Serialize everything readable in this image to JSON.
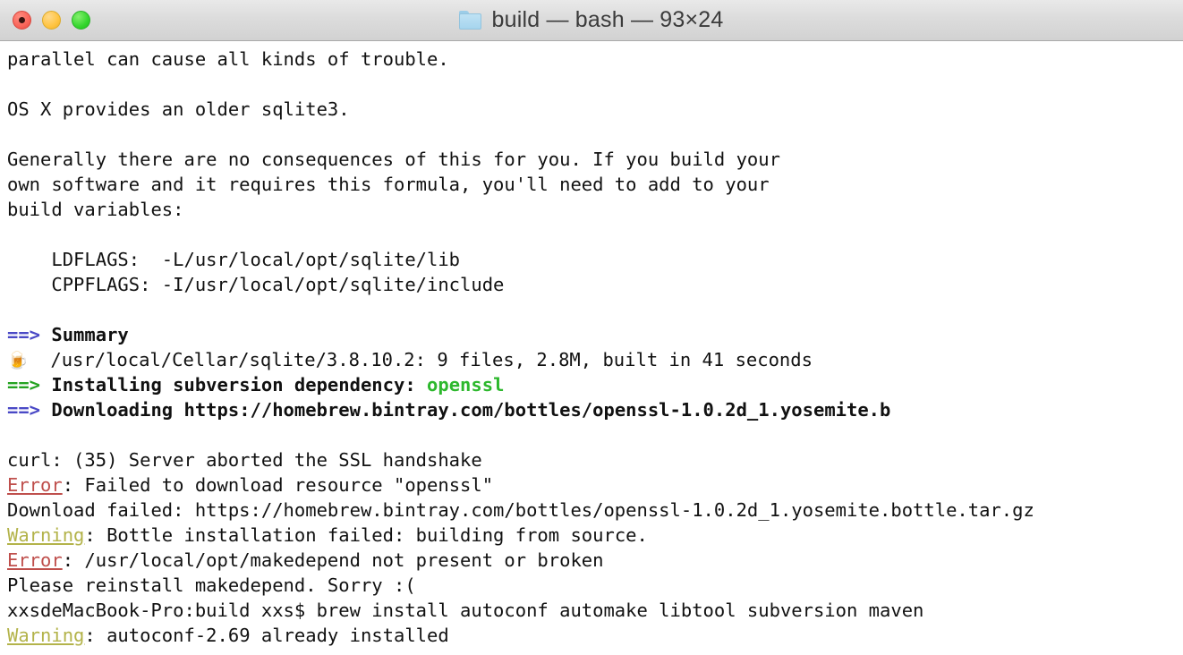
{
  "window": {
    "title": "build — bash — 93×24",
    "folder_icon": "folder-icon",
    "controls": {
      "close_label": "close",
      "minimize_label": "minimize",
      "maximize_label": "maximize"
    }
  },
  "terminal": {
    "columns": 93,
    "rows": 24,
    "background_color": "#ffffff",
    "foreground_color": "#111111",
    "colors": {
      "arrow_blue": "#4a49c6",
      "arrow_green": "#24a321",
      "green": "#2db82d",
      "error_red": "#bf4f4c",
      "warning_yellow": "#b3b34a"
    },
    "lines": [
      {
        "id": "l01",
        "segments": [
          {
            "text": "parallel can cause all kinds of trouble.",
            "style": "plain"
          }
        ]
      },
      {
        "id": "l02",
        "segments": [
          {
            "text": "",
            "style": "plain"
          }
        ]
      },
      {
        "id": "l03",
        "segments": [
          {
            "text": "OS X provides an older sqlite3.",
            "style": "plain"
          }
        ]
      },
      {
        "id": "l04",
        "segments": [
          {
            "text": "",
            "style": "plain"
          }
        ]
      },
      {
        "id": "l05",
        "segments": [
          {
            "text": "Generally there are no consequences of this for you. If you build your",
            "style": "plain"
          }
        ]
      },
      {
        "id": "l06",
        "segments": [
          {
            "text": "own software and it requires this formula, you'll need to add to your",
            "style": "plain"
          }
        ]
      },
      {
        "id": "l07",
        "segments": [
          {
            "text": "build variables:",
            "style": "plain"
          }
        ]
      },
      {
        "id": "l08",
        "segments": [
          {
            "text": "",
            "style": "plain"
          }
        ]
      },
      {
        "id": "l09",
        "segments": [
          {
            "text": "    LDFLAGS:  -L/usr/local/opt/sqlite/lib",
            "style": "plain"
          }
        ]
      },
      {
        "id": "l10",
        "segments": [
          {
            "text": "    CPPFLAGS: -I/usr/local/opt/sqlite/include",
            "style": "plain"
          }
        ]
      },
      {
        "id": "l11",
        "segments": [
          {
            "text": "",
            "style": "plain"
          }
        ]
      },
      {
        "id": "l12",
        "segments": [
          {
            "text": "==>",
            "style": "arrow"
          },
          {
            "text": " Summary",
            "style": "bold"
          }
        ]
      },
      {
        "id": "l13",
        "segments": [
          {
            "text": "🍺",
            "style": "beer"
          },
          {
            "text": "  /usr/local/Cellar/sqlite/3.8.10.2: 9 files, 2.8M, built in 41 seconds",
            "style": "plain"
          }
        ]
      },
      {
        "id": "l14",
        "segments": [
          {
            "text": "==>",
            "style": "arrow-green"
          },
          {
            "text": " Installing subversion dependency: ",
            "style": "bold"
          },
          {
            "text": "openssl",
            "style": "green"
          }
        ]
      },
      {
        "id": "l15",
        "segments": [
          {
            "text": "==>",
            "style": "arrow"
          },
          {
            "text": " Downloading https://homebrew.bintray.com/bottles/openssl-1.0.2d_1.yosemite.b",
            "style": "bold"
          }
        ]
      },
      {
        "id": "l16",
        "segments": [
          {
            "text": "",
            "style": "plain"
          }
        ]
      },
      {
        "id": "l17",
        "segments": [
          {
            "text": "curl: (35) Server aborted the SSL handshake",
            "style": "plain"
          }
        ]
      },
      {
        "id": "l18",
        "segments": [
          {
            "text": "Error",
            "style": "error"
          },
          {
            "text": ": Failed to download resource \"openssl\"",
            "style": "plain"
          }
        ]
      },
      {
        "id": "l19",
        "segments": [
          {
            "text": "Download failed: https://homebrew.bintray.com/bottles/openssl-1.0.2d_1.yosemite.bottle.tar.gz",
            "style": "plain"
          }
        ]
      },
      {
        "id": "l20",
        "segments": [
          {
            "text": "Warning",
            "style": "warning"
          },
          {
            "text": ": Bottle installation failed: building from source.",
            "style": "plain"
          }
        ]
      },
      {
        "id": "l21",
        "segments": [
          {
            "text": "Error",
            "style": "error"
          },
          {
            "text": ": /usr/local/opt/makedepend not present or broken",
            "style": "plain"
          }
        ]
      },
      {
        "id": "l22",
        "segments": [
          {
            "text": "Please reinstall makedepend. Sorry :(",
            "style": "plain"
          }
        ]
      },
      {
        "id": "l23",
        "segments": [
          {
            "text": "xxsdeMacBook-Pro:build xxs$ brew install autoconf automake libtool subversion maven",
            "style": "plain"
          }
        ]
      },
      {
        "id": "l24",
        "segments": [
          {
            "text": "Warning",
            "style": "warning"
          },
          {
            "text": ": autoconf-2.69 already installed",
            "style": "plain"
          }
        ]
      }
    ]
  }
}
